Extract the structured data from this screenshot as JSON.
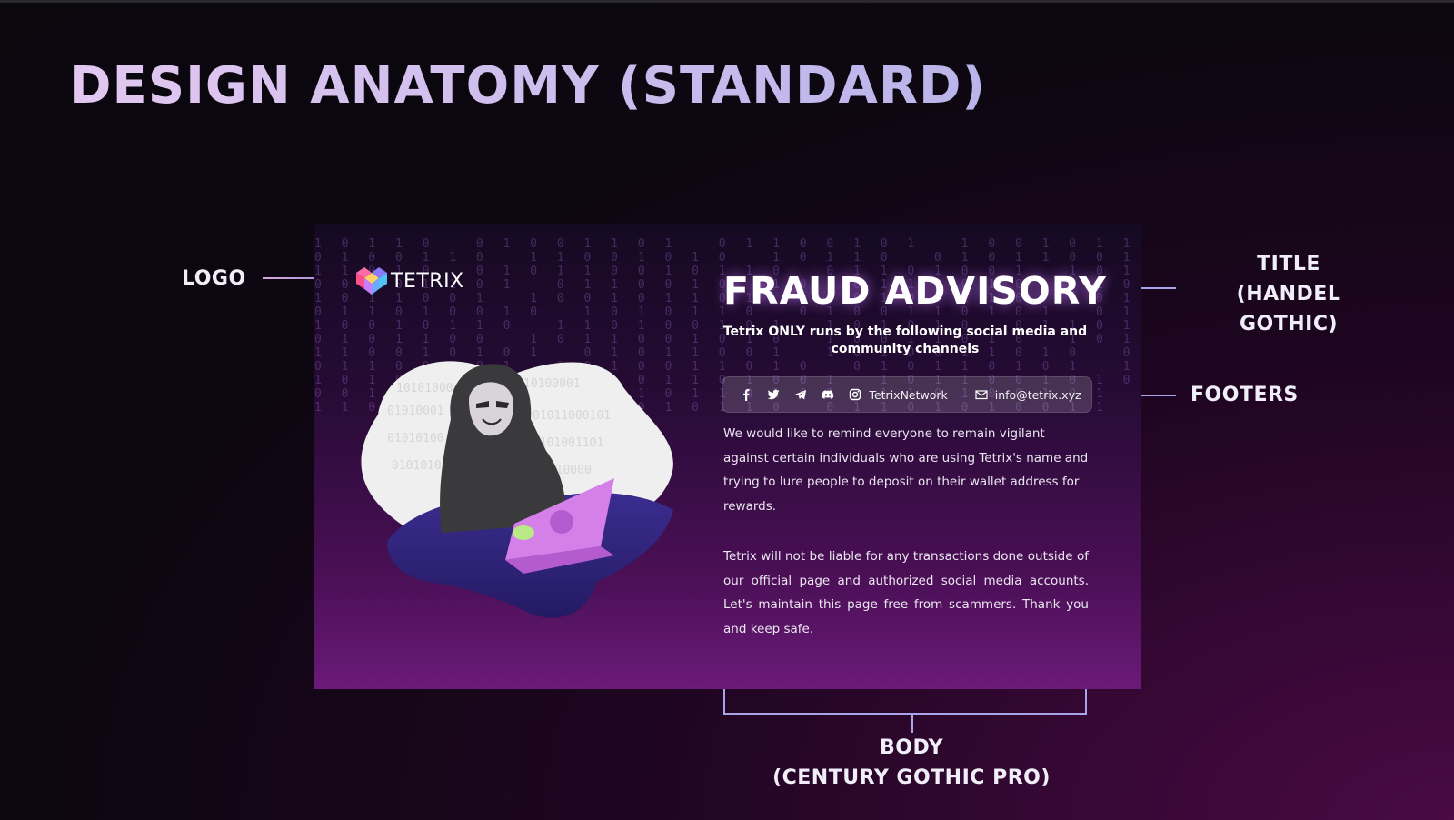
{
  "page": {
    "title": "DESIGN ANATOMY (STANDARD)"
  },
  "annotations": {
    "logo": "LOGO",
    "title_line1": "TITLE",
    "title_line2": "(HANDEL GOTHIC)",
    "footers": "FOOTERS",
    "body_line1": "BODY",
    "body_line2": "(CENTURY GOTHIC PRO)"
  },
  "card": {
    "logo_text": "TETRIX",
    "title": "FRAUD ADVISORY",
    "subtitle": "Tetrix ONLY runs by the following social media and community channels",
    "footer": {
      "handle": "TetrixNetwork",
      "email": "info@tetrix.xyz",
      "icons": [
        "facebook-icon",
        "twitter-icon",
        "telegram-icon",
        "discord-icon",
        "instagram-icon",
        "mail-icon"
      ]
    },
    "paragraph1": "We would like to remind everyone to remain vigilant against certain individuals who are using Tetrix's name and trying to lure people to deposit on their wallet address for rewards.",
    "paragraph2": "Tetrix will not be liable for any transactions done outside of our official page and authorized social media accounts. Let's maintain this page free from scammers. Thank you and keep safe."
  },
  "colors": {
    "accent_line": "#a7a4e8",
    "title_gradient_start": "#e2c8f0",
    "title_gradient_end": "#b9b4ea"
  }
}
